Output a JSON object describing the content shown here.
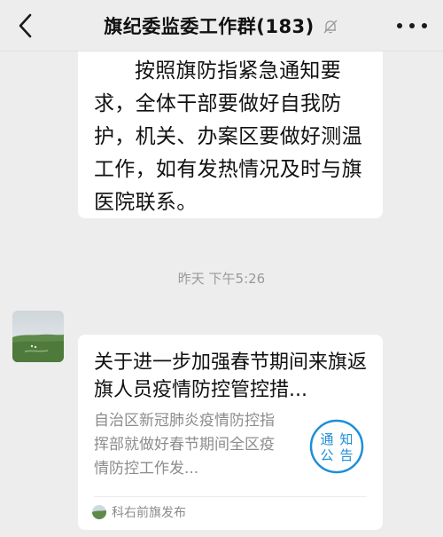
{
  "header": {
    "title": "旗纪委监委工作群(183)",
    "back_icon": "chevron-left-icon",
    "mute_icon": "bell-off-icon",
    "more_icon": "more-dots-icon"
  },
  "messages": {
    "text_message": "按照旗防指紧急通知要求，全体干部要做好自我防护，机关、办案区要做好测温工作，如有发热情况及时与旗医院联系。",
    "timestamp": "昨天 下午5:26",
    "article": {
      "title": "关于进一步加强春节期间来旗返旗人员疫情防控管控措...",
      "description": "自治区新冠肺炎疫情防控指挥部就做好春节期间全区疫情防控工作发...",
      "thumbnail_text_1": "通知",
      "thumbnail_text_2": "公告",
      "source": "科右前旗发布"
    }
  },
  "colors": {
    "background": "#ededed",
    "bubble": "#ffffff",
    "accent_blue": "#1e8fd6",
    "muted_text": "#8c8c8c"
  }
}
